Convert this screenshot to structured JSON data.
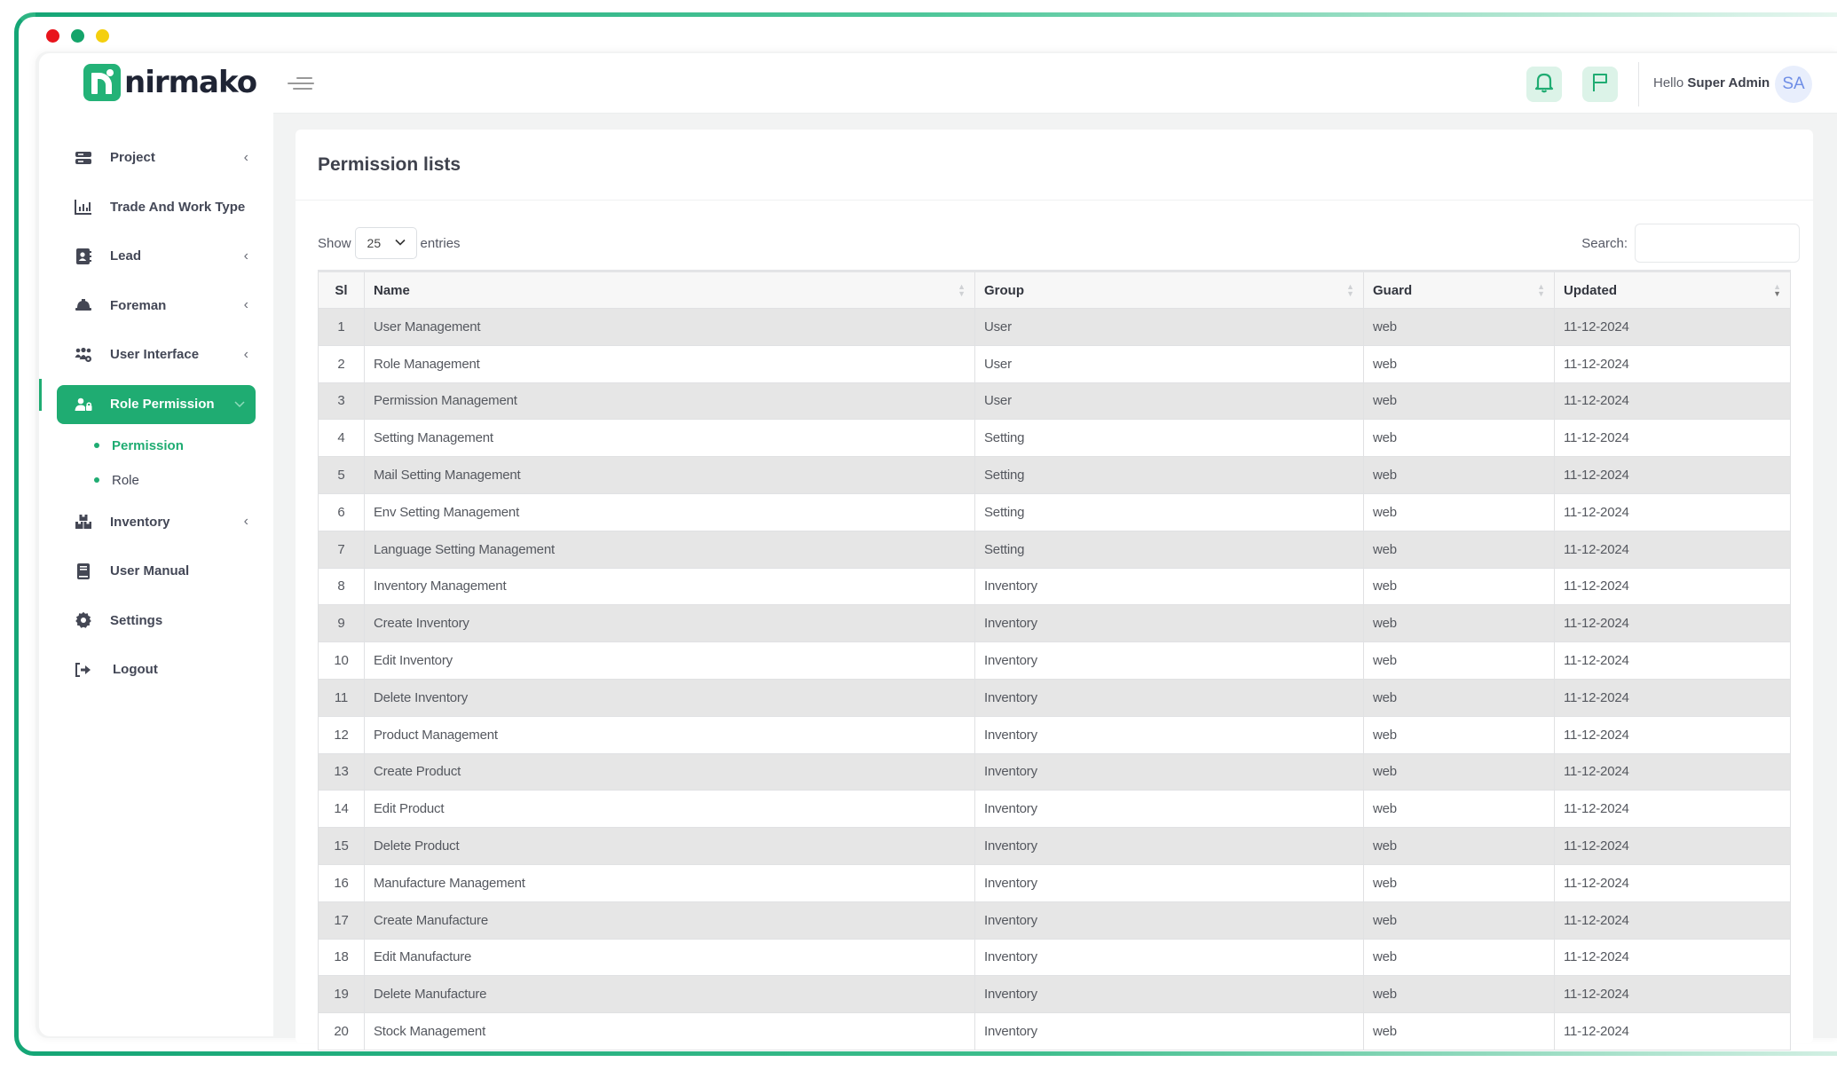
{
  "window": {
    "controls": [
      {
        "name": "close",
        "color": "#e8141c"
      },
      {
        "name": "minimize",
        "color": "#14a46a"
      },
      {
        "name": "maximize",
        "color": "#f4cf0e"
      }
    ],
    "accent_color": "#1fac72"
  },
  "brand": {
    "name": "nirmako"
  },
  "sidebar": {
    "items": [
      {
        "label": "Project",
        "icon": "server-icon",
        "has_submenu": true
      },
      {
        "label": "Trade And Work Type",
        "icon": "bar-chart-icon",
        "has_submenu": false
      },
      {
        "label": "Lead",
        "icon": "contact-book-icon",
        "has_submenu": true
      },
      {
        "label": "Foreman",
        "icon": "hard-hat-icon",
        "has_submenu": true
      },
      {
        "label": "User Interface",
        "icon": "users-cog-icon",
        "has_submenu": true
      },
      {
        "label": "Role Permission",
        "icon": "user-lock-icon",
        "has_submenu": true,
        "active": true,
        "children": [
          {
            "label": "Permission",
            "current": true
          },
          {
            "label": "Role",
            "current": false
          }
        ]
      },
      {
        "label": "Inventory",
        "icon": "boxes-icon",
        "has_submenu": true
      },
      {
        "label": "User Manual",
        "icon": "book-icon",
        "has_submenu": false
      },
      {
        "label": "Settings",
        "icon": "gear-icon",
        "has_submenu": false
      },
      {
        "label": "Logout",
        "icon": "logout-icon",
        "has_submenu": false
      }
    ]
  },
  "header": {
    "greeting": "Hello",
    "user_name": "Super Admin",
    "avatar_initials": "SA",
    "notification_icon": "bell-icon",
    "flag_icon": "flag-icon",
    "menu_icon": "hamburger-icon"
  },
  "page": {
    "title": "Permission lists",
    "length": {
      "show_label": "Show",
      "value": "25",
      "entries_label": "entries"
    },
    "search": {
      "label": "Search:",
      "value": "",
      "placeholder": ""
    }
  },
  "table": {
    "columns": [
      "Sl",
      "Name",
      "Group",
      "Guard",
      "Updated"
    ],
    "sorted_column": "Updated",
    "rows": [
      {
        "sl": "1",
        "name": "User Management",
        "group": "User",
        "guard": "web",
        "updated": "11-12-2024"
      },
      {
        "sl": "2",
        "name": "Role Management",
        "group": "User",
        "guard": "web",
        "updated": "11-12-2024"
      },
      {
        "sl": "3",
        "name": "Permission Management",
        "group": "User",
        "guard": "web",
        "updated": "11-12-2024"
      },
      {
        "sl": "4",
        "name": "Setting Management",
        "group": "Setting",
        "guard": "web",
        "updated": "11-12-2024"
      },
      {
        "sl": "5",
        "name": "Mail Setting Management",
        "group": "Setting",
        "guard": "web",
        "updated": "11-12-2024"
      },
      {
        "sl": "6",
        "name": "Env Setting Management",
        "group": "Setting",
        "guard": "web",
        "updated": "11-12-2024"
      },
      {
        "sl": "7",
        "name": "Language Setting Management",
        "group": "Setting",
        "guard": "web",
        "updated": "11-12-2024"
      },
      {
        "sl": "8",
        "name": "Inventory Management",
        "group": "Inventory",
        "guard": "web",
        "updated": "11-12-2024"
      },
      {
        "sl": "9",
        "name": "Create Inventory",
        "group": "Inventory",
        "guard": "web",
        "updated": "11-12-2024"
      },
      {
        "sl": "10",
        "name": "Edit Inventory",
        "group": "Inventory",
        "guard": "web",
        "updated": "11-12-2024"
      },
      {
        "sl": "11",
        "name": "Delete Inventory",
        "group": "Inventory",
        "guard": "web",
        "updated": "11-12-2024"
      },
      {
        "sl": "12",
        "name": "Product Management",
        "group": "Inventory",
        "guard": "web",
        "updated": "11-12-2024"
      },
      {
        "sl": "13",
        "name": "Create Product",
        "group": "Inventory",
        "guard": "web",
        "updated": "11-12-2024"
      },
      {
        "sl": "14",
        "name": "Edit Product",
        "group": "Inventory",
        "guard": "web",
        "updated": "11-12-2024"
      },
      {
        "sl": "15",
        "name": "Delete Product",
        "group": "Inventory",
        "guard": "web",
        "updated": "11-12-2024"
      },
      {
        "sl": "16",
        "name": "Manufacture Management",
        "group": "Inventory",
        "guard": "web",
        "updated": "11-12-2024"
      },
      {
        "sl": "17",
        "name": "Create Manufacture",
        "group": "Inventory",
        "guard": "web",
        "updated": "11-12-2024"
      },
      {
        "sl": "18",
        "name": "Edit Manufacture",
        "group": "Inventory",
        "guard": "web",
        "updated": "11-12-2024"
      },
      {
        "sl": "19",
        "name": "Delete Manufacture",
        "group": "Inventory",
        "guard": "web",
        "updated": "11-12-2024"
      },
      {
        "sl": "20",
        "name": "Stock Management",
        "group": "Inventory",
        "guard": "web",
        "updated": "11-12-2024"
      }
    ]
  }
}
